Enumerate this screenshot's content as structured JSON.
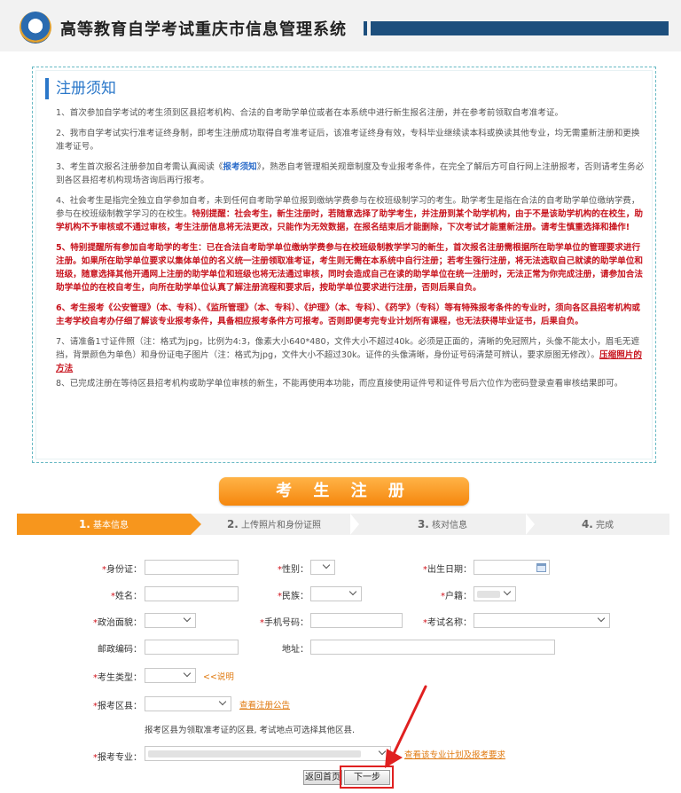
{
  "header": {
    "title": "高等教育自学考试重庆市信息管理系统"
  },
  "notice": {
    "title": "注册须知",
    "p1": "1、首次参加自学考试的考生须到区县招考机构、合法的自考助学单位或者在本系统中进行新生报名注册，并在参考前领取自考准考证。",
    "p2": "2、我市自学考试实行准考证终身制，即考生注册成功取得自考准考证后，该准考证终身有效，专科毕业继续读本科或换读其他专业，均无需重新注册和更换准考证号。",
    "p3a": "3、考生首次报名注册参加自考需认真阅读《",
    "p3link": "报考须知",
    "p3b": "》，熟悉自考管理相关规章制度及专业报考条件，在完全了解后方可自行网上注册报考，否则请考生务必到各区县招考机构现场咨询后再行报考。",
    "p4a": "4、社会考生是指完全独立自学参加自考，未到任何自考助学单位报到缴纳学费参与在校班级制学习的考生。助学考生是指在合法的自考助学单位缴纳学费，参与在校班级制教学学习的在校生。",
    "p4red": "特别提醒：社会考生，新生注册时，若随意选择了助学考生，并注册到某个助学机构，由于不是该助学机构的在校生，助学机构不予审核或不通过审核，考生注册信息将无法更改，只能作为无效数据，在报名结束后才能删除，下次考试才能重新注册。请考生慎重选择和操作!",
    "p5": "5、特别提醒所有参加自考助学的考生：已在合法自考助学单位缴纳学费参与在校班级制教学学习的新生，首次报名注册需根据所在助学单位的管理要求进行注册。如果所在助学单位要求以集体单位的名义统一注册领取准考证，考生则无需在本系统中自行注册；若考生强行注册，将无法选取自己就读的助学单位和班级，随意选择其他开通网上注册的助学单位和班级也将无法通过审核，同时会造成自己在读的助学单位在统一注册时，无法正常为你完成注册，请参加合法助学单位的在校自考生，向所在助学单位认真了解注册流程和要求后，按助学单位要求进行注册，否则后果自负。",
    "p6": "6、考生报考《公安管理》（本、专科）、《监所管理》（本、专科）、《护理》（本、专科）、《药学》（专科）等有特殊报考条件的专业时，须向各区县招考机构或主考学校自考办仔细了解该专业报考条件，具备相应报考条件方可报考。否则即便考完专业计划所有课程，也无法获得毕业证书，后果自负。",
    "p7a": "7、请准备1寸证件照（注：格式为jpg，比例为4:3，像素大小640*480，文件大小不超过40k。必须是正面的，清晰的免冠照片，头像不能太小，眉毛无遮挡，背景颜色为单色）和身份证电子图片（注：格式为jpg，文件大小不超过30k。证件的头像清晰，身份证号码清楚可辨认，要求原图无修改）。",
    "p7link": "压缩照片的方法",
    "p8": "8、已完成注册在等待区县招考机构或助学单位审核的新生，不能再使用本功能，而应直接使用证件号和证件号后六位作为密码登录查看审核结果即可。"
  },
  "banner": "考 生 注 册",
  "steps": [
    {
      "num": "1.",
      "label": "基本信息"
    },
    {
      "num": "2.",
      "label": "上传照片和身份证照"
    },
    {
      "num": "3.",
      "label": "核对信息"
    },
    {
      "num": "4.",
      "label": "完成"
    }
  ],
  "form": {
    "id_card": "身份证：",
    "gender": "性别：",
    "birth_date": "出生日期：",
    "name": "姓名：",
    "ethnicity": "民族：",
    "household": "户籍：",
    "political": "政治面貌：",
    "phone": "手机号码：",
    "exam_name": "考试名称：",
    "postcode": "邮政编码：",
    "address": "地址：",
    "candidate_type": "考生类型：",
    "explain_link": "<<说明",
    "region": "报考区县：",
    "view_notice_link": "查看注册公告",
    "region_hint": "报考区县为领取准考证的区县, 考试地点可选择其他区县.",
    "major": "报考专业：",
    "major_plan_link": "查看该专业计划及报考要求"
  },
  "buttons": {
    "back": "返回首页",
    "next": "下一步"
  }
}
